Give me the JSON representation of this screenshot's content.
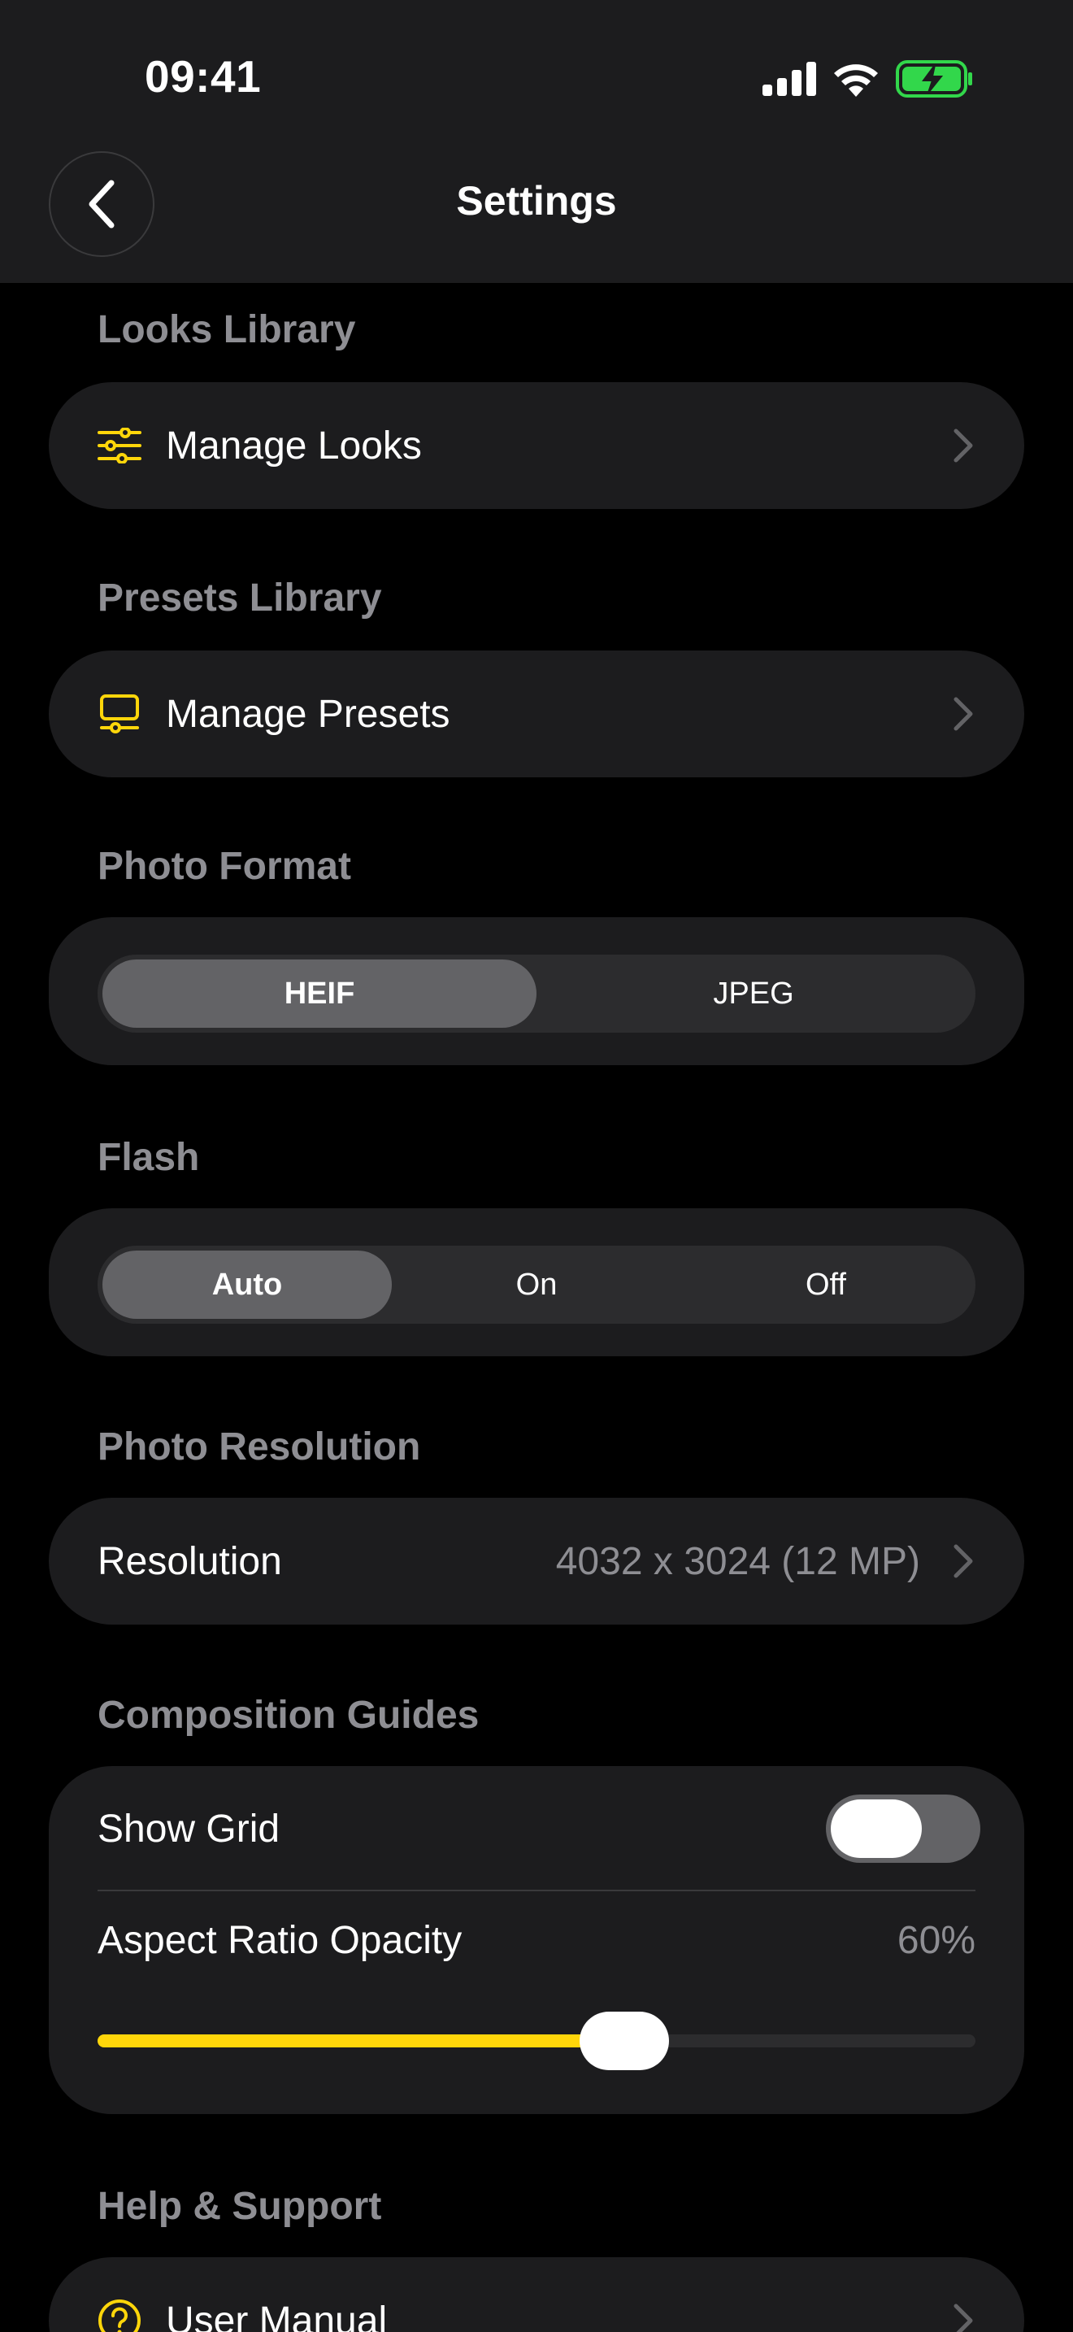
{
  "status_bar": {
    "time": "09:41"
  },
  "nav": {
    "title": "Settings"
  },
  "sections": {
    "looks": {
      "title": "Looks Library",
      "row_label": "Manage Looks"
    },
    "presets": {
      "title": "Presets Library",
      "row_label": "Manage Presets"
    },
    "photo_format": {
      "title": "Photo Format",
      "options": [
        "HEIF",
        "JPEG"
      ],
      "selected": "HEIF"
    },
    "flash": {
      "title": "Flash",
      "options": [
        "Auto",
        "On",
        "Off"
      ],
      "selected": "Auto"
    },
    "resolution": {
      "title": "Photo Resolution",
      "row_label": "Resolution",
      "value": "4032 x 3024 (12 MP)"
    },
    "composition": {
      "title": "Composition Guides",
      "show_grid_label": "Show Grid",
      "show_grid_on": false,
      "opacity_label": "Aspect Ratio Opacity",
      "opacity_value": "60%",
      "opacity_fraction": 0.6
    },
    "help": {
      "title": "Help & Support",
      "row_label": "User Manual"
    }
  },
  "colors": {
    "accent": "#ffd60a",
    "battery": "#32d74b",
    "card": "#1c1c1e"
  },
  "icons": [
    "back-chevron-icon",
    "sliders-icon",
    "preset-icon",
    "chevron-right-icon",
    "question-circle-icon",
    "cellular-signal-icon",
    "wifi-icon",
    "battery-charging-icon"
  ]
}
